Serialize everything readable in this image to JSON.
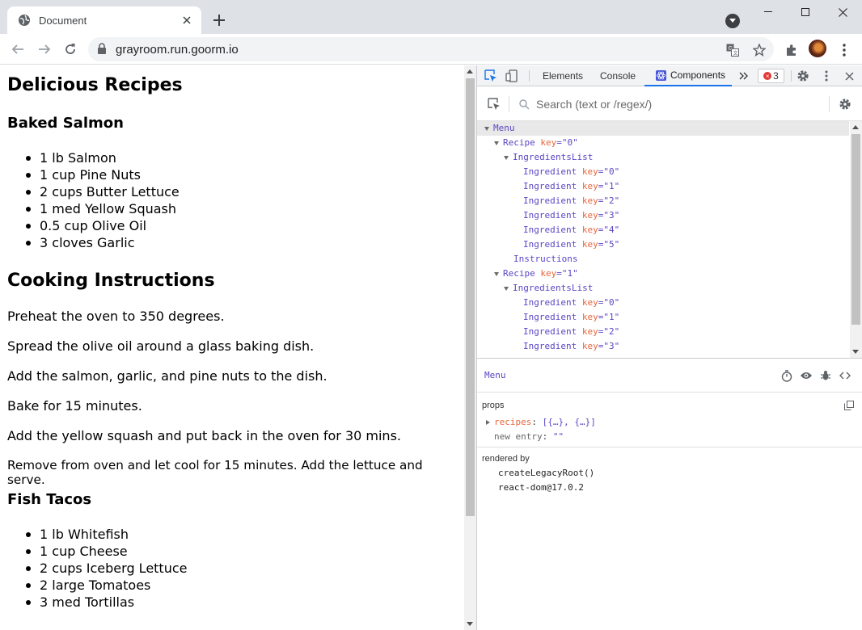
{
  "browser": {
    "tab_title": "Document",
    "url": "grayroom.run.goorm.io"
  },
  "page": {
    "title": "Delicious Recipes",
    "recipe1": {
      "name": "Baked Salmon",
      "ingredients": [
        "1 lb Salmon",
        "1 cup Pine Nuts",
        "2 cups Butter Lettuce",
        "1 med Yellow Squash",
        "0.5 cup Olive Oil",
        "3 cloves Garlic"
      ]
    },
    "instructions_heading": "Cooking Instructions",
    "instructions": [
      "Preheat the oven to 350 degrees.",
      "Spread the olive oil around a glass baking dish.",
      "Add the salmon, garlic, and pine nuts to the dish.",
      "Bake for 15 minutes.",
      "Add the yellow squash and put back in the oven for 30 mins.",
      "Remove from oven and let cool for 15 minutes. Add the lettuce and serve."
    ],
    "recipe2": {
      "name": "Fish Tacos",
      "ingredients": [
        "1 lb Whitefish",
        "1 cup Cheese",
        "2 cups Iceberg Lettuce",
        "2 large Tomatoes",
        "3 med Tortillas"
      ]
    }
  },
  "devtools": {
    "tabs": {
      "elements": "Elements",
      "console": "Console",
      "components": "Components"
    },
    "error_count": "3",
    "search_placeholder": "Search (text or /regex/)",
    "tree": {
      "menu": "Menu",
      "recipe": "Recipe",
      "ingredients_list": "IngredientsList",
      "ingredient": "Ingredient",
      "instructions": "Instructions",
      "key_attr": "key",
      "keys_r0": [
        "\"0\"",
        "\"1\"",
        "\"2\"",
        "\"3\"",
        "\"4\"",
        "\"5\""
      ],
      "recipe_keys": [
        "\"0\"",
        "\"1\""
      ],
      "keys_r1": [
        "\"0\"",
        "\"1\"",
        "\"2\"",
        "\"3\""
      ]
    },
    "selected_component": "Menu",
    "props_label": "props",
    "props": {
      "recipes_name": "recipes",
      "recipes_value": "[{…}, {…}]",
      "new_entry_name": "new entry",
      "new_entry_value": "\"\""
    },
    "rendered_by_label": "rendered by",
    "rendered_by": [
      "createLegacyRoot()",
      "react-dom@17.0.2"
    ]
  },
  "colors": {
    "component_purple": "#5c45c4",
    "key_orange": "#e8663d",
    "tab_active_blue": "#1a73e8"
  }
}
